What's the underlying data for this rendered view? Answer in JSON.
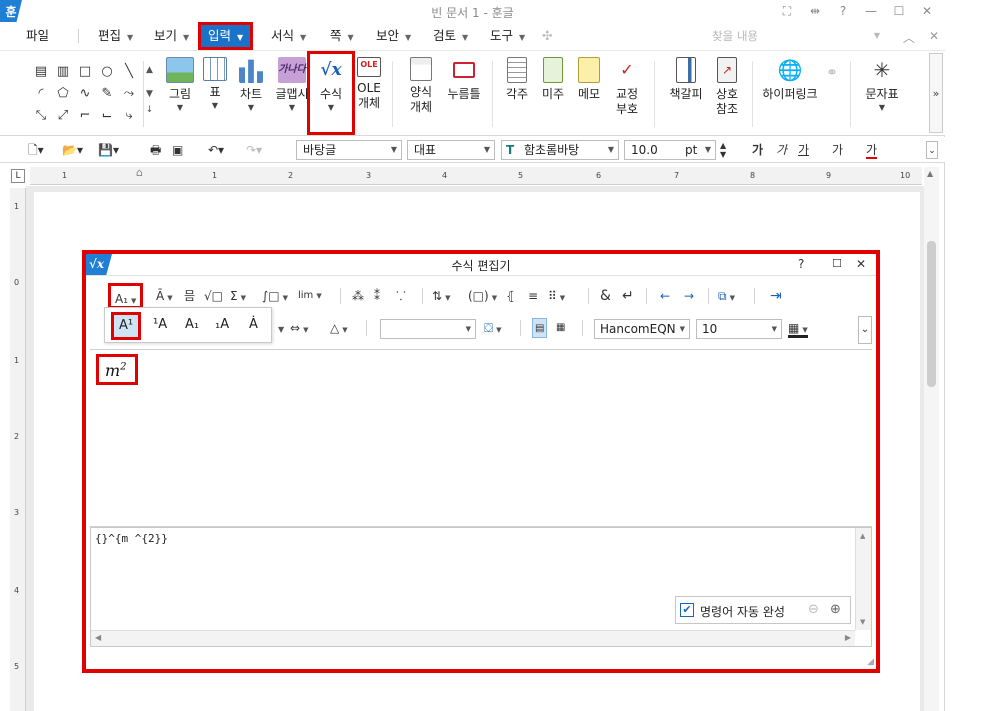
{
  "app": {
    "logo": "훈",
    "title": "빈 문서 1 - 훈글",
    "window_controls": [
      "⛶",
      "⇹",
      "?",
      "—",
      "☐",
      "✕"
    ]
  },
  "menu": {
    "items": [
      "파일",
      "편집",
      "보기",
      "입력",
      "서식",
      "쪽",
      "보안",
      "검토",
      "도구"
    ],
    "active": "입력",
    "search_placeholder": "찾을 내용",
    "right_controls": [
      "︿",
      "✕"
    ]
  },
  "ribbon": {
    "buttons": [
      {
        "label": "그림",
        "icon": "picture-icon"
      },
      {
        "label": "표",
        "icon": "table-icon"
      },
      {
        "label": "차트",
        "icon": "chart-icon"
      },
      {
        "label": "글맵시",
        "icon": "wordart-icon"
      },
      {
        "label": "수식",
        "icon": "formula-icon"
      },
      {
        "label": "OLE\n개체",
        "icon": "ole-icon"
      },
      {
        "label": "양식\n개체",
        "icon": "form-icon"
      },
      {
        "label": "누름틀",
        "icon": "field-icon"
      },
      {
        "label": "각주",
        "icon": "footnote-icon"
      },
      {
        "label": "미주",
        "icon": "endnote-icon"
      },
      {
        "label": "메모",
        "icon": "memo-icon"
      },
      {
        "label": "교정\n부호",
        "icon": "proofmark-icon"
      },
      {
        "label": "책갈피",
        "icon": "bookmark-icon"
      },
      {
        "label": "상호\n참조",
        "icon": "crossref-icon"
      },
      {
        "label": "하이퍼링크",
        "icon": "hyperlink-icon"
      },
      {
        "label": "문자표",
        "icon": "charmap-icon"
      }
    ],
    "ole_badge": "OLE",
    "wordart_badge": "가나다",
    "formula_badge": "√x",
    "more": "»"
  },
  "format_bar": {
    "style": "바탕글",
    "language": "대표",
    "font": "함초롬바탕",
    "size": "10.0",
    "unit": "pt",
    "char_buttons": [
      "가",
      "가",
      "가",
      "가",
      "가"
    ]
  },
  "ruler": {
    "corner": "L",
    "h_numbers": [
      "1",
      "1",
      "2",
      "3",
      "4",
      "5",
      "6",
      "7",
      "8",
      "9",
      "10"
    ],
    "v_numbers": [
      "1",
      "0",
      "1",
      "2",
      "3",
      "4",
      "5"
    ]
  },
  "eq_editor": {
    "title": "수식 편집기",
    "logo": "√x",
    "help": "?",
    "maximize": "☐",
    "close": "✕",
    "toolbar1": [
      {
        "label": "A₁",
        "name": "script-button",
        "dd": true
      },
      {
        "label": "Ā",
        "name": "decoration-button",
        "dd": true
      },
      {
        "label": "믐",
        "name": "fraction-button"
      },
      {
        "label": "√□",
        "name": "root-button"
      },
      {
        "label": "Σ",
        "name": "sum-button",
        "dd": true
      },
      {
        "label": "∫□",
        "name": "integral-button",
        "dd": true
      },
      {
        "label": "lim",
        "name": "limit-button",
        "dd": true
      },
      {
        "label": "⁂",
        "name": "matrix-sep-1"
      },
      {
        "label": "⁑",
        "name": "matrix-sep-2"
      },
      {
        "label": "⸪",
        "name": "matrix-sep-3"
      },
      {
        "label": "⇅",
        "name": "arrow-button",
        "dd": true
      },
      {
        "label": "(□)",
        "name": "brackets-button",
        "dd": true
      },
      {
        "label": "⦃",
        "name": "cases-button"
      },
      {
        "label": "≡",
        "name": "pile-button"
      },
      {
        "label": "⠿",
        "name": "matrix-button",
        "dd": true
      },
      {
        "label": "&",
        "name": "ampersand-button"
      },
      {
        "label": "↵",
        "name": "newline-button"
      },
      {
        "label": "←",
        "name": "undo-button"
      },
      {
        "label": "→",
        "name": "redo-button"
      },
      {
        "label": "⧉",
        "name": "insert-button",
        "dd": true
      },
      {
        "label": "⇥",
        "name": "exit-button"
      }
    ],
    "script_options": [
      "A¹",
      "¹A",
      "A₁",
      "₁A",
      "Ȧ"
    ],
    "toolbar2": [
      {
        "label": "⇔",
        "name": "arrows-2-button",
        "dd": true
      },
      {
        "label": "△",
        "name": "shapes-2-button",
        "dd": true
      }
    ],
    "symbol_combo": "",
    "font_combo": "HancomEQN",
    "size_combo": "10",
    "equation": {
      "base": "m",
      "sup": "2"
    },
    "script_text": "{}^{m ^{2}}",
    "autocomplete_label": "명령어 자동 완성",
    "autocomplete_checked": "✔"
  }
}
